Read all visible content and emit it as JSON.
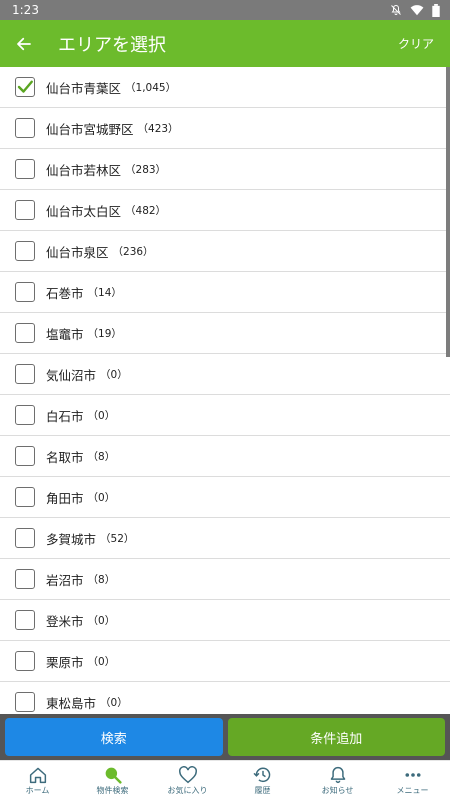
{
  "status": {
    "time": "1:23"
  },
  "header": {
    "title": "エリアを選択",
    "clear_label": "クリア"
  },
  "areas": [
    {
      "name": "仙台市青葉区",
      "count": "（1,045）",
      "checked": true
    },
    {
      "name": "仙台市宮城野区",
      "count": "（423）",
      "checked": false
    },
    {
      "name": "仙台市若林区",
      "count": "（283）",
      "checked": false
    },
    {
      "name": "仙台市太白区",
      "count": "（482）",
      "checked": false
    },
    {
      "name": "仙台市泉区",
      "count": "（236）",
      "checked": false
    },
    {
      "name": "石巻市",
      "count": "（14）",
      "checked": false
    },
    {
      "name": "塩竈市",
      "count": "（19）",
      "checked": false
    },
    {
      "name": "気仙沼市",
      "count": "（0）",
      "checked": false
    },
    {
      "name": "白石市",
      "count": "（0）",
      "checked": false
    },
    {
      "name": "名取市",
      "count": "（8）",
      "checked": false
    },
    {
      "name": "角田市",
      "count": "（0）",
      "checked": false
    },
    {
      "name": "多賀城市",
      "count": "（52）",
      "checked": false
    },
    {
      "name": "岩沼市",
      "count": "（8）",
      "checked": false
    },
    {
      "name": "登米市",
      "count": "（0）",
      "checked": false
    },
    {
      "name": "栗原市",
      "count": "（0）",
      "checked": false
    },
    {
      "name": "東松島市",
      "count": "（0）",
      "checked": false
    }
  ],
  "actions": {
    "search_label": "検索",
    "add_condition_label": "条件追加"
  },
  "nav": [
    {
      "label": "ホーム",
      "icon": "home-icon"
    },
    {
      "label": "物件検索",
      "icon": "search-icon"
    },
    {
      "label": "お気に入り",
      "icon": "heart-icon"
    },
    {
      "label": "履歴",
      "icon": "history-icon"
    },
    {
      "label": "お知らせ",
      "icon": "bell-icon"
    },
    {
      "label": "メニュー",
      "icon": "more-icon"
    }
  ],
  "colors": {
    "accent": "#6cbb2c",
    "search_button": "#1e88e5",
    "add_button": "#65a825",
    "check": "#5aa521"
  }
}
